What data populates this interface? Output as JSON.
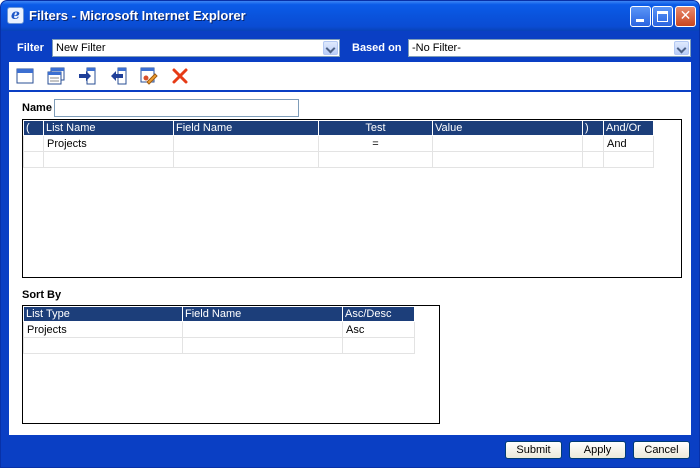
{
  "window": {
    "title": "Filters - Microsoft Internet Explorer",
    "icon": "ie-icon"
  },
  "filterbar": {
    "filter_label": "Filter",
    "filter_value": "New Filter",
    "based_on_label": "Based on",
    "based_on_value": "-No Filter-"
  },
  "toolbar": {
    "icons": [
      "new-icon",
      "open-icon",
      "move-right-icon",
      "move-left-icon",
      "edit-icon",
      "delete-icon"
    ]
  },
  "form": {
    "name_label": "Name",
    "name_value": ""
  },
  "criteria": {
    "columns": [
      "(",
      "List Name",
      "Field Name",
      "Test",
      "Value",
      ")",
      "And/Or"
    ],
    "rows": [
      [
        "",
        "Projects",
        "",
        "=",
        "",
        "",
        "And"
      ],
      [
        "",
        "",
        "",
        "",
        "",
        "",
        ""
      ]
    ]
  },
  "sort": {
    "label": "Sort By",
    "columns": [
      "List Type",
      "Field Name",
      "Asc/Desc"
    ],
    "rows": [
      [
        "Projects",
        "",
        "Asc"
      ],
      [
        "",
        "",
        ""
      ]
    ]
  },
  "buttons": {
    "submit": "Submit",
    "apply": "Apply",
    "cancel": "Cancel"
  },
  "colors": {
    "frame": "#0a3fc4",
    "grid_header": "#1c3e7a",
    "delete_icon": "#e63b16"
  }
}
